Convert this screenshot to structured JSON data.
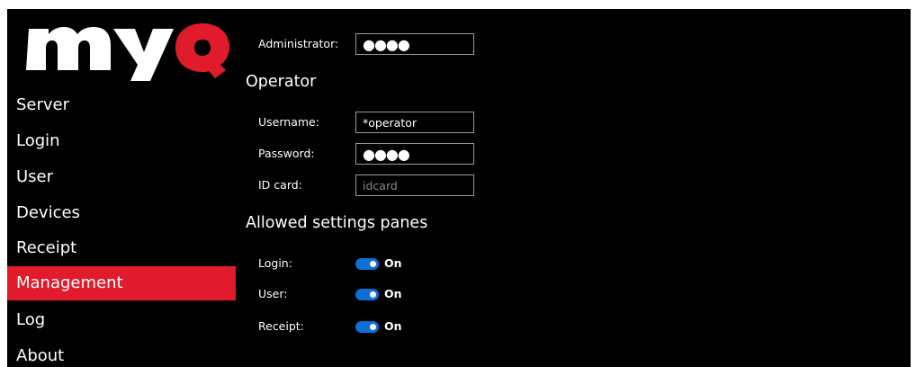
{
  "logo": {
    "text": "myQ",
    "brand_color": "#e01b2c"
  },
  "sidebar": {
    "items": [
      {
        "label": "Server"
      },
      {
        "label": "Login"
      },
      {
        "label": "User"
      },
      {
        "label": "Devices"
      },
      {
        "label": "Receipt"
      },
      {
        "label": "Management",
        "active": true
      },
      {
        "label": "Log"
      },
      {
        "label": "About"
      }
    ],
    "active_color": "#e01b2c"
  },
  "main": {
    "administrator": {
      "label": "Administrator:",
      "value": "●●●●"
    },
    "operator": {
      "title": "Operator",
      "username": {
        "label": "Username:",
        "value": "*operator"
      },
      "password": {
        "label": "Password:",
        "value": "●●●●"
      },
      "id_card": {
        "label": "ID card:",
        "placeholder": "idcard"
      }
    },
    "allowed_panes": {
      "title": "Allowed settings panes",
      "toggles": [
        {
          "label": "Login:",
          "state": "On"
        },
        {
          "label": "User:",
          "state": "On"
        },
        {
          "label": "Receipt:",
          "state": "On"
        }
      ],
      "toggle_color": "#0e6fd6"
    }
  }
}
